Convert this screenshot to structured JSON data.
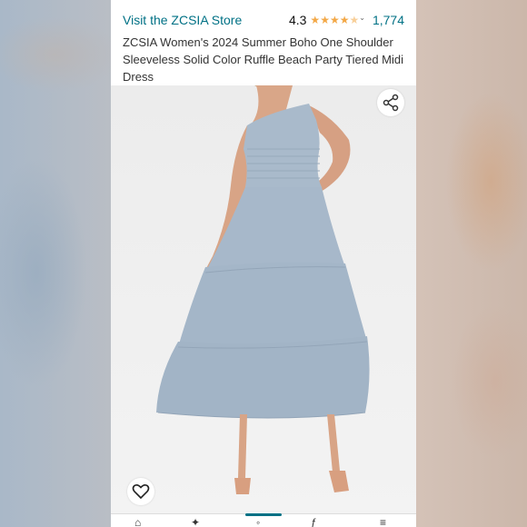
{
  "header": {
    "store_link": "Visit the ZCSIA Store",
    "rating": "4.3",
    "rating_value": 4.3,
    "review_count": "1,774",
    "title": "ZCSIA Women's 2024 Summer Boho One Shoulder Sleeveless Solid Color Ruffle Beach Party Tiered Midi Dress"
  },
  "icons": {
    "share": "share-icon",
    "favorite": "heart-icon"
  },
  "colors": {
    "link": "#007185",
    "star": "#f3a847",
    "dress": "#a7b9cb"
  }
}
